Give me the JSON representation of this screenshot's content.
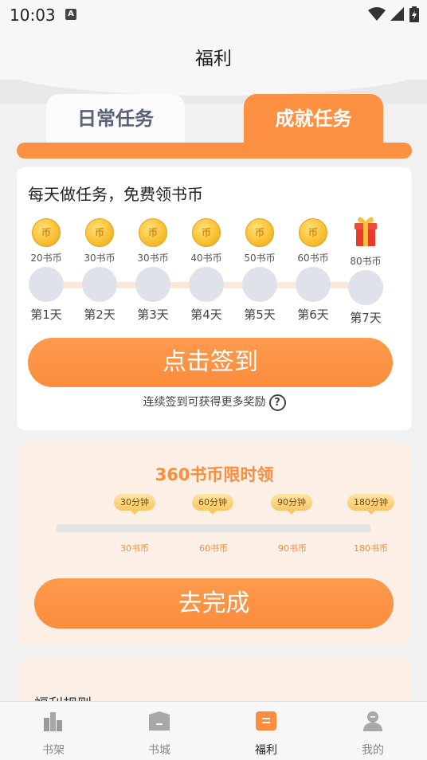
{
  "status_bar": {
    "time": "10:03",
    "notification_badge": "A"
  },
  "header": {
    "title": "福利"
  },
  "tabs": [
    {
      "label": "日常任务",
      "active": false
    },
    {
      "label": "成就任务",
      "active": true
    }
  ],
  "signin": {
    "title": "每天做任务，免费领书币",
    "coin_char": "币",
    "days": [
      {
        "reward": "20书币",
        "label": "第1天"
      },
      {
        "reward": "30书币",
        "label": "第2天"
      },
      {
        "reward": "30书币",
        "label": "第3天"
      },
      {
        "reward": "40书币",
        "label": "第4天"
      },
      {
        "reward": "50书币",
        "label": "第5天"
      },
      {
        "reward": "60书币",
        "label": "第6天"
      },
      {
        "reward": "80书币",
        "label": "第7天"
      }
    ],
    "button_label": "点击签到",
    "hint": "连续签到可获得更多奖励",
    "help_symbol": "?"
  },
  "reading": {
    "title": "360书币限时领",
    "milestones": [
      {
        "time": "30分钟",
        "reward": "30书币"
      },
      {
        "time": "60分钟",
        "reward": "60书币"
      },
      {
        "time": "90分钟",
        "reward": "90书币"
      },
      {
        "time": "180分钟",
        "reward": "180书币"
      }
    ],
    "progress": 0,
    "button_label": "去完成"
  },
  "rules": {
    "title": "福利规则"
  },
  "bottom_nav": [
    {
      "label": "书架",
      "icon": "bookshelf-icon",
      "active": false
    },
    {
      "label": "书城",
      "icon": "bookstore-icon",
      "active": false
    },
    {
      "label": "福利",
      "icon": "welfare-icon",
      "active": true
    },
    {
      "label": "我的",
      "icon": "profile-icon",
      "active": false
    }
  ],
  "colors": {
    "accent": "#fb8d3c",
    "card_tint": "#fcefe6",
    "coin_gold": "#f9c134",
    "inactive_tab_text": "#5a6278"
  }
}
